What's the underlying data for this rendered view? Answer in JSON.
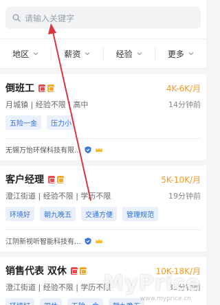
{
  "search": {
    "placeholder": "请输入关键字"
  },
  "filters": [
    {
      "label": "地区"
    },
    {
      "label": "薪资"
    },
    {
      "label": "经验"
    },
    {
      "label": "更多"
    }
  ],
  "jobs": [
    {
      "title": "倒班工",
      "salary": "4K-6K/月",
      "meta": "月城镇 | 经验不限 | 高中",
      "time": "14分钟前",
      "tags": [
        "五险一金",
        "压力小"
      ],
      "company": "无锡万怡环保科技有限..."
    },
    {
      "title": "客户经理",
      "salary": "5K-10K/月",
      "meta": "澄江街道 | 经验不限 | 学历不限",
      "time": "19分钟前",
      "tags": [
        "环境好",
        "朝九晚五",
        "交通方便",
        "管理规范"
      ],
      "company": "江阴新视听智能科技有..."
    },
    {
      "title": "销售代表 双休",
      "salary": "10K-18K/月",
      "meta": "澄江街道 | 经验不限 | 学历不限",
      "time": "33分钟前",
      "tags": [
        "环境好",
        "双休",
        "五险一金",
        "朝九晚五"
      ],
      "company": ""
    }
  ],
  "watermark": {
    "text": "MyPrice",
    "sub": "www.myprice.cn"
  },
  "colors": {
    "salary": "#f29a1e",
    "tag_text": "#2f6fd6",
    "annotation_arrow": "#d9363e"
  }
}
